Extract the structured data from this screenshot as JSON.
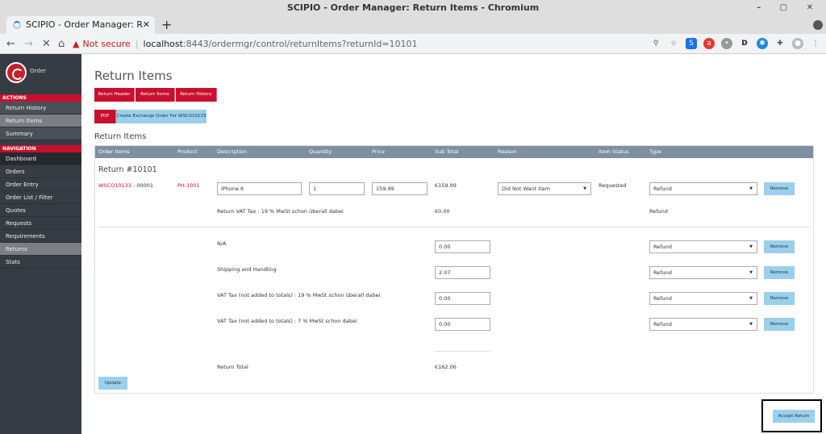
{
  "window": {
    "title": "SCIPIO - Order Manager: Return Items - Chromium"
  },
  "tab": {
    "title": "SCIPIO - Order Manager: R",
    "close": "✕",
    "new": "+"
  },
  "address": {
    "security_warning": "Not secure",
    "host": "localhost",
    "path": ":8443/ordermgr/control/returnItems?returnId=10101"
  },
  "sidebar": {
    "logo_label": "Order",
    "actions_header": "ACTIONS",
    "actions": [
      "Return History",
      "Return Items",
      "Summary"
    ],
    "navigation_header": "NAVIGATION",
    "nav": [
      "Dashboard",
      "Orders",
      "Order Entry",
      "Order List / Filter",
      "Quotes",
      "Requests",
      "Requirements",
      "Returns",
      "Stats"
    ]
  },
  "page": {
    "title": "Return Items",
    "tabs": [
      "Return Header",
      "Return Items",
      "Return History"
    ],
    "pdf_button": "PDF",
    "exchange_button": "Create Exchange Order For WSCO10133",
    "section_title": "Return Items"
  },
  "table": {
    "headers": [
      "Order Items",
      "Product",
      "Description",
      "Quantity",
      "Price",
      "Sub Total",
      "Reason",
      "Item Status",
      "Type"
    ],
    "return_number": "Return #10101",
    "item": {
      "order_id": "WSCO10133",
      "order_seq": " - 00001",
      "product": "PH-1001",
      "description": "iPhone 6",
      "quantity": "1",
      "price": "159.99",
      "subtotal": "€159.99",
      "reason": "Did Not Want Item",
      "status": "Requested",
      "type": "Refund",
      "remove": "Remove"
    },
    "vat_line": {
      "label": "Return VAT Tax : 19 % MwSt schon überall dabei",
      "amount": "€0.00",
      "type": "Refund"
    },
    "adjustments": [
      {
        "label": "N/A",
        "amount": "0.00",
        "type": "Refund",
        "remove": "Remove"
      },
      {
        "label": "Shipping and Handling",
        "amount": "2.07",
        "type": "Refund",
        "remove": "Remove"
      },
      {
        "label": "VAT Tax (not added to totals) : 19 % MwSt schon überall dabei",
        "amount": "0.00",
        "type": "Refund",
        "remove": "Remove"
      },
      {
        "label": "VAT Tax (not added to totals) : 7 % MwSt schon dabei",
        "amount": "0.00",
        "type": "Refund",
        "remove": "Remove"
      }
    ],
    "total_label": "Return Total",
    "total_amount": "€162.06",
    "update_button": "Update"
  },
  "accept_button": "Accept Return",
  "colors": {
    "brand_red": "#c8102e",
    "sidebar": "#363c44",
    "table_header": "#7d8fa0",
    "light_button": "#9ad0ec"
  }
}
